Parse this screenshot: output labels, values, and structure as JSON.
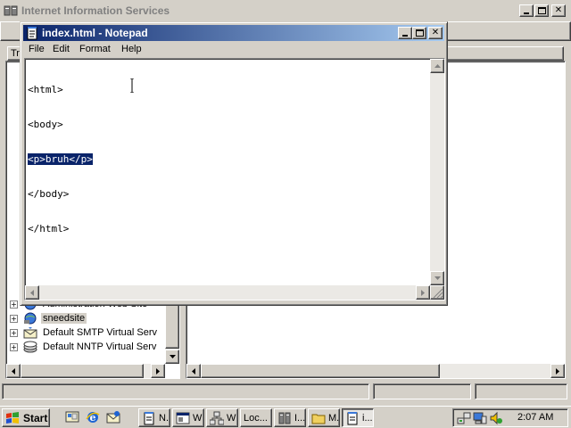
{
  "iis": {
    "title": "Internet Information Services",
    "tree_header": "Tre",
    "tree_items": [
      {
        "label": "Administration Web Site",
        "icon": "website-icon"
      },
      {
        "label": "sneedsite",
        "icon": "website-icon"
      },
      {
        "label": "Default SMTP Virtual Serv",
        "icon": "smtp-server-icon"
      },
      {
        "label": "Default NNTP Virtual Serv",
        "icon": "nntp-server-icon"
      }
    ]
  },
  "notepad": {
    "title": "index.html - Notepad",
    "menu": [
      "File",
      "Edit",
      "Format",
      "Help"
    ],
    "lines": [
      "<html>",
      "<body>",
      "<p>bruh</p>",
      "</body>",
      "</html>"
    ],
    "selected_line_index": 2,
    "selection_color": "#0a246a"
  },
  "taskbar": {
    "start_label": "Start",
    "quick_launch": [
      "show-desktop-icon",
      "internet-explorer-icon",
      "outlook-express-icon"
    ],
    "buttons": [
      {
        "label": "N...",
        "icon": "notepad-icon"
      },
      {
        "label": "W",
        "icon": "console-icon"
      },
      {
        "label": "W",
        "icon": "network-icon"
      },
      {
        "label": "Loc...",
        "icon": "none"
      },
      {
        "label": "I...",
        "icon": "server-icon"
      },
      {
        "label": "M...",
        "icon": "folder-icon"
      },
      {
        "label": "i...",
        "icon": "notepad-icon",
        "active": true
      }
    ],
    "tray_icons": [
      "network-tray-icon",
      "computer-tray-icon",
      "volume-tray-icon"
    ],
    "clock": "2:07 AM"
  },
  "colors": {
    "window_face": "#d4d0c8",
    "active_title_start": "#0a246a",
    "active_title_end": "#a6caf0",
    "inactive_title_text": "#808080"
  }
}
